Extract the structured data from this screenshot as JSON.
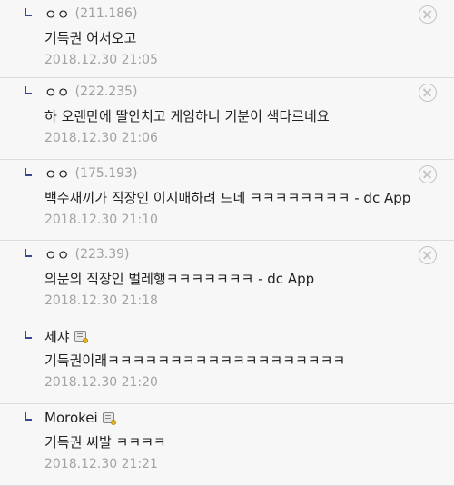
{
  "comments": [
    {
      "author": "ㅇㅇ",
      "ip": "(211.186)",
      "text": "기득권 어서오고",
      "date": "2018.12.30 21:05",
      "deletable": true
    },
    {
      "author": "ㅇㅇ",
      "ip": "(222.235)",
      "text": "하 오랜만에 딸안치고 게임하니 기분이 색다르네요",
      "date": "2018.12.30 21:06",
      "deletable": true
    },
    {
      "author": "ㅇㅇ",
      "ip": "(175.193)",
      "text": "백수새끼가 직장인 이지매하려 드네 ㅋㅋㅋㅋㅋㅋㅋㅋ - dc App",
      "date": "2018.12.30 21:10",
      "deletable": true
    },
    {
      "author": "ㅇㅇ",
      "ip": "(223.39)",
      "text": "의문의 직장인 벌레행ㅋㅋㅋㅋㅋㅋㅋ - dc App",
      "date": "2018.12.30 21:18",
      "deletable": true
    },
    {
      "author": "세쟈",
      "ip": "",
      "gallog_icon": "gallog-memo-icon",
      "text": "기득권이래ㅋㅋㅋㅋㅋㅋㅋㅋㅋㅋㅋㅋㅋㅋㅋㅋㅋㅋㅋ",
      "date": "2018.12.30 21:20",
      "deletable": false
    },
    {
      "author": "Morokei",
      "ip": "",
      "gallog_icon": "gallog-memo-icon",
      "text": "기득권 씨발 ㅋㅋㅋㅋ",
      "date": "2018.12.30 21:21",
      "deletable": false
    }
  ],
  "icons": {
    "reply": "reply-arrow-icon",
    "delete": "delete-circle-x-icon"
  },
  "colors": {
    "reply_arrow": "#3b4890",
    "meta_text": "#a3a3a3",
    "divider": "#dcdcdc",
    "background": "#f7f7f7"
  }
}
